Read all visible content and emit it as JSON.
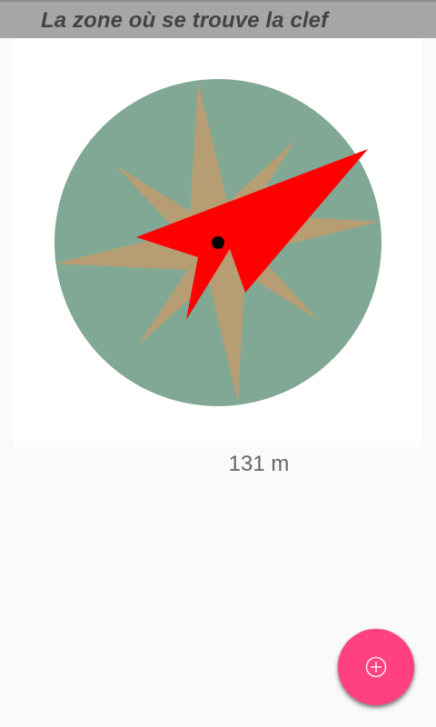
{
  "header": {
    "title": "La zone où se trouve la clef"
  },
  "compass": {
    "dial_color": "#80a894",
    "star_color": "#c79b6b",
    "needle_color": "#ff0000",
    "pivot_color": "#000000"
  },
  "distance": {
    "text": "131 m"
  },
  "fab": {
    "icon": "add-circle-icon",
    "color": "#ff4081"
  }
}
